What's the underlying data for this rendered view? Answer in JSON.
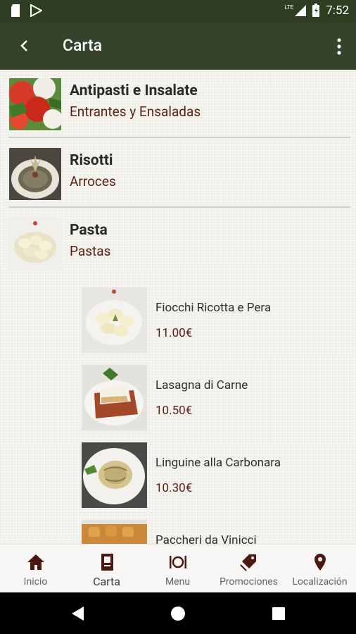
{
  "status_bar": {
    "network": "LTE",
    "time": "7:52"
  },
  "app_bar": {
    "title": "Carta"
  },
  "categories": [
    {
      "name": "Antipasti e Insalate",
      "subtitle": "Entrantes y Ensaladas"
    },
    {
      "name": "Risotti",
      "subtitle": "Arroces"
    },
    {
      "name": "Pasta",
      "subtitle": "Pastas"
    }
  ],
  "dishes": [
    {
      "name": "Fiocchi Ricotta e Pera",
      "price": "11.00€"
    },
    {
      "name": "Lasagna di Carne",
      "price": "10.50€"
    },
    {
      "name": "Linguine alla Carbonara",
      "price": "10.30€"
    },
    {
      "name": "Paccheri da Vinicci",
      "price": ""
    }
  ],
  "bottom_nav": {
    "items": [
      {
        "label": "Inicio",
        "icon": "home-icon"
      },
      {
        "label": "Carta",
        "icon": "menu-book-icon"
      },
      {
        "label": "Menu",
        "icon": "plate-cutlery-icon"
      },
      {
        "label": "Promociones",
        "icon": "tag-icon"
      },
      {
        "label": "Localización",
        "icon": "location-pin-icon"
      }
    ],
    "active_index": 1
  },
  "colors": {
    "app_bar": "#34432a",
    "status_bar": "#2f3d22",
    "accent_text": "#5c1f16",
    "nav_icon": "#4a1a12"
  }
}
